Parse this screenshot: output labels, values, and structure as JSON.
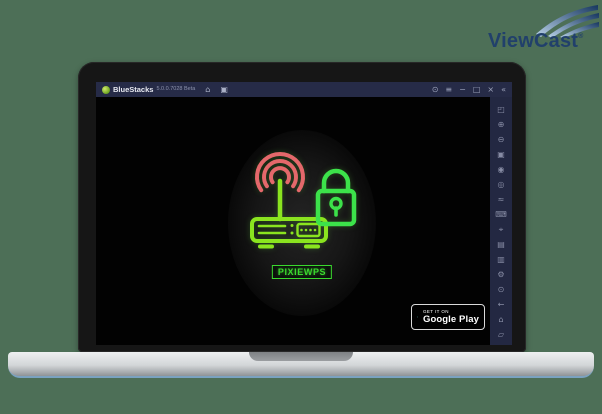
{
  "page": {
    "background": "#4d6f57"
  },
  "viewcast": {
    "name": "ViewCast",
    "reg": "®"
  },
  "bluestacks": {
    "titlebar": {
      "app_name": "BlueStacks",
      "version": "5.0.0.7028 Beta",
      "tab_icons": [
        {
          "name": "home-tab",
          "glyph": "⌂"
        },
        {
          "name": "app-tab",
          "glyph": "▣"
        }
      ],
      "controls": [
        {
          "name": "boost",
          "glyph": "⊙"
        },
        {
          "name": "menu",
          "glyph": "≡"
        },
        {
          "name": "minimize",
          "glyph": "−"
        },
        {
          "name": "maximize",
          "glyph": "□"
        },
        {
          "name": "close",
          "glyph": "×"
        },
        {
          "name": "collapse-sidebar",
          "glyph": "«"
        }
      ]
    },
    "sidebar": {
      "top_icons": [
        {
          "name": "fullscreen-icon",
          "glyph": "◰"
        },
        {
          "name": "volume-up-icon",
          "glyph": "⊕"
        },
        {
          "name": "volume-down-icon",
          "glyph": "⊖"
        },
        {
          "name": "screenshot-icon",
          "glyph": "▣"
        },
        {
          "name": "camera-icon",
          "glyph": "◉"
        },
        {
          "name": "rotate-icon",
          "glyph": "◎"
        },
        {
          "name": "shake-icon",
          "glyph": "≈"
        },
        {
          "name": "keyboard-controls-icon",
          "glyph": "⌨"
        },
        {
          "name": "aim-assist-icon",
          "glyph": "⌖"
        },
        {
          "name": "media-manager-icon",
          "glyph": "▤"
        },
        {
          "name": "multi-instance-icon",
          "glyph": "▥"
        },
        {
          "name": "settings-gear-icon",
          "glyph": "⚙"
        }
      ],
      "bottom_icons": [
        {
          "name": "eco-mode-icon",
          "glyph": "⊙"
        },
        {
          "name": "back-icon",
          "glyph": "←"
        },
        {
          "name": "home-icon",
          "glyph": "⌂"
        },
        {
          "name": "recent-apps-icon",
          "glyph": "▱"
        }
      ]
    },
    "main": {
      "app_label": "PIXIEWPS",
      "play_badge": {
        "tagline": "GET IT ON",
        "store": "Google Play"
      }
    },
    "colors": {
      "titlebar_bg": "#262b47",
      "sidebar_bg": "#232842",
      "router_green": "#8ae41f",
      "lock_green": "#3ce24a",
      "wifi_red": "#e4686b",
      "label_green": "#3bd92f",
      "laptop_base_edge": "#7aa2c0",
      "page_background": "#4d6f57"
    }
  }
}
